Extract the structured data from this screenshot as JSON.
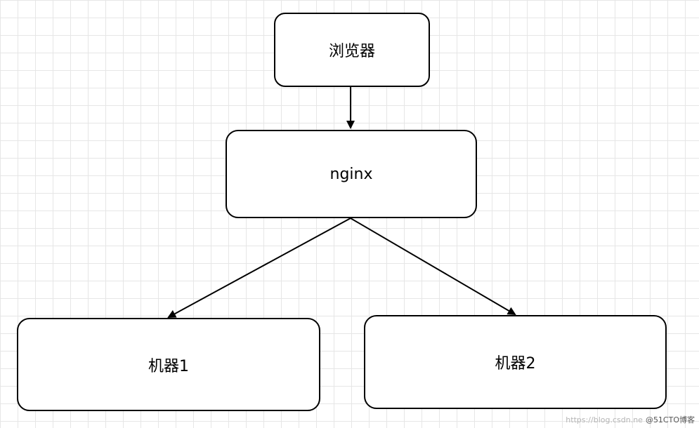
{
  "nodes": {
    "browser": "浏览器",
    "nginx": "nginx",
    "machine1": "机器1",
    "machine2": "机器2"
  },
  "edges": [
    {
      "from": "browser",
      "to": "nginx"
    },
    {
      "from": "nginx",
      "to": "machine1"
    },
    {
      "from": "nginx",
      "to": "machine2"
    }
  ],
  "watermark": {
    "url": "https://blog.csdn.ne",
    "brand": "@51CTO博客"
  }
}
